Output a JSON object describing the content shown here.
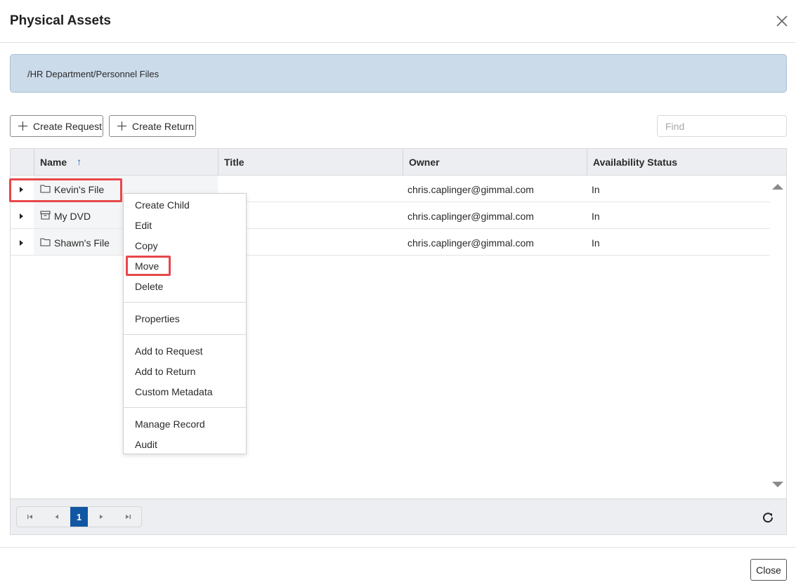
{
  "dialog": {
    "title": "Physical Assets",
    "close_icon": "close-icon"
  },
  "path": "/HR Department/Personnel Files",
  "toolbar": {
    "create_request": "Create Request",
    "create_return": "Create Return",
    "find_placeholder": "Find",
    "find_value": ""
  },
  "grid": {
    "columns": [
      "Name",
      "Title",
      "Owner",
      "Availability Status"
    ],
    "sort_indicator": "↑",
    "rows": [
      {
        "name": "Kevin's File",
        "icon": "folder-icon",
        "title": "",
        "owner": "chris.caplinger@gimmal.com",
        "status": "In"
      },
      {
        "name": "My DVD",
        "icon": "archive-box-icon",
        "title": "",
        "owner": "chris.caplinger@gimmal.com",
        "status": "In"
      },
      {
        "name": "Shawn's File",
        "icon": "folder-icon",
        "title": "",
        "owner": "chris.caplinger@gimmal.com",
        "status": "In"
      }
    ]
  },
  "context_menu": {
    "items": [
      "Create Child",
      "Edit",
      "Copy",
      "Move",
      "Delete",
      "Properties",
      "Add to Request",
      "Add to Return",
      "Custom Metadata",
      "Manage Record",
      "Audit"
    ]
  },
  "pager": {
    "current_page": "1"
  },
  "footer": {
    "close_label": "Close"
  },
  "colors": {
    "highlight": "#e8474b",
    "accent": "#1156a3",
    "path_bar": "#ccdbea"
  }
}
